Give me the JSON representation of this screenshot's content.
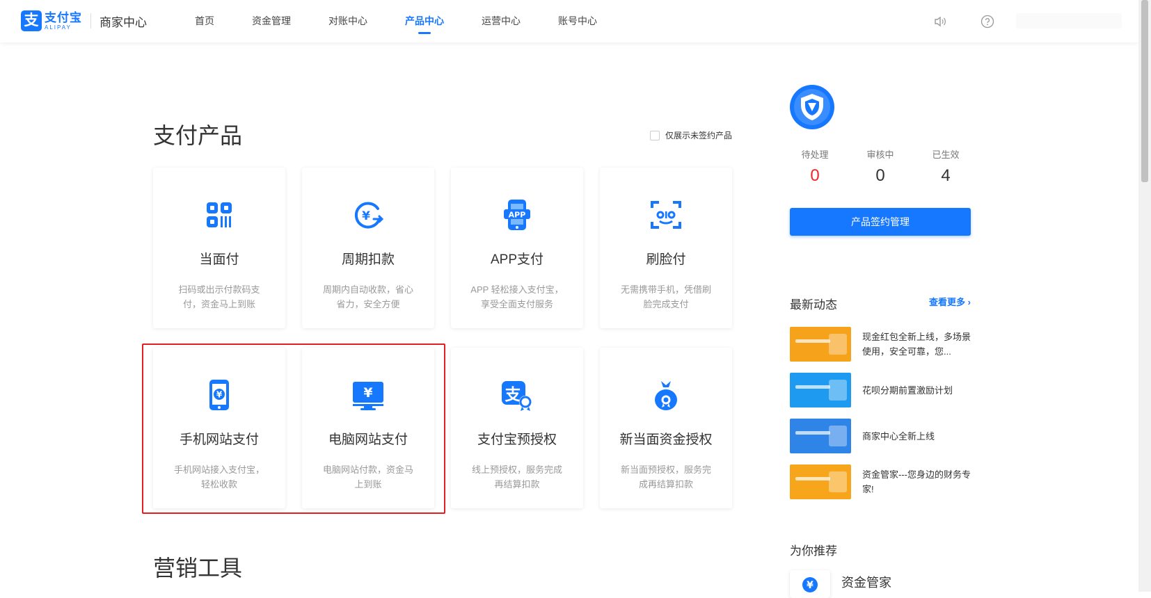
{
  "header": {
    "logo_mark": "支",
    "logo_cn": "支付宝",
    "logo_en": "ALIPAY",
    "logo_sub": "商家中心",
    "nav": [
      "首页",
      "资金管理",
      "对账中心",
      "产品中心",
      "运营中心",
      "账号中心"
    ],
    "nav_active": "产品中心",
    "accent": "#1677ff"
  },
  "main": {
    "payment_title": "支付产品",
    "filter_label": "仅展示未签约产品",
    "products": [
      {
        "title": "当面付",
        "desc": "扫码或出示付款码支付，资金马上到账",
        "icon": "qr-scan-icon"
      },
      {
        "title": "周期扣款",
        "desc": "周期内自动收款，省心省力，安全方便",
        "icon": "cycle-yuan-icon"
      },
      {
        "title": "APP支付",
        "desc": "APP 轻松接入支付宝，享受全面支付服务",
        "icon": "app-phone-icon"
      },
      {
        "title": "刷脸付",
        "desc": "无需携带手机，凭借刷脸完成支付",
        "icon": "face-scan-icon"
      },
      {
        "title": "手机网站支付",
        "desc": "手机网站接入支付宝，轻松收款",
        "icon": "mobile-yuan-icon"
      },
      {
        "title": "电脑网站支付",
        "desc": "电脑网站付款，资金马上到账",
        "icon": "monitor-yuan-icon"
      },
      {
        "title": "支付宝预授权",
        "desc": "线上预授权，服务完成再结算扣款",
        "icon": "alipay-badge-icon"
      },
      {
        "title": "新当面资金授权",
        "desc": "新当面预授权，服务完成再结算扣款",
        "icon": "money-bag-icon"
      }
    ],
    "marketing_title": "营销工具"
  },
  "side": {
    "stats": [
      {
        "label": "待处理",
        "value": "0"
      },
      {
        "label": "审核中",
        "value": "0"
      },
      {
        "label": "已生效",
        "value": "4"
      }
    ],
    "button": "产品签约管理",
    "news_title": "最新动态",
    "news_more": "查看更多 ›",
    "news": [
      {
        "text": "现金红包全新上线，多场景使用，安全可靠，您...",
        "color": "#f6a21b"
      },
      {
        "text": "花呗分期前置激励计划",
        "color": "#1e9bf0"
      },
      {
        "text": "商家中心全新上线",
        "color": "#2f84e8"
      },
      {
        "text": "资金管家---您身边的财务专家!",
        "color": "#f7a61c"
      }
    ],
    "rec_title": "为你推荐",
    "rec_item": "资金管家"
  }
}
